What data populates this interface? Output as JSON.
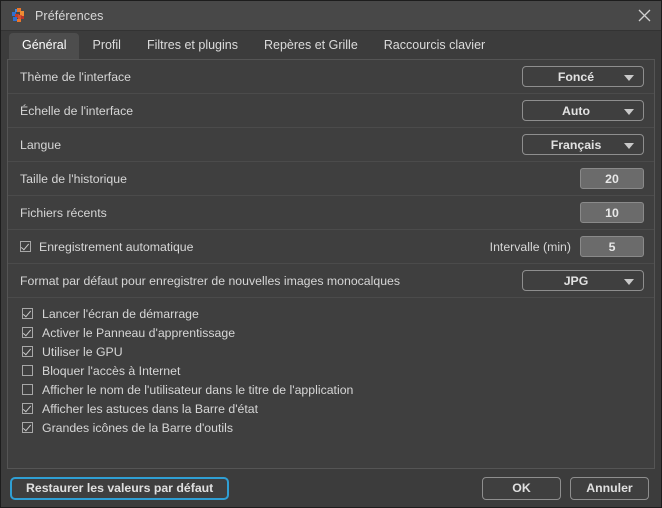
{
  "window": {
    "title": "Préférences",
    "app_icon": "application-logo-icon",
    "close_icon": "close-icon",
    "accent_color": "#2f9fd4",
    "background_color": "#3c3c3c",
    "panel_color": "#3f3f3f",
    "titlebar_color": "#484848"
  },
  "tabs": [
    {
      "label": "Général",
      "active": true
    },
    {
      "label": "Profil",
      "active": false
    },
    {
      "label": "Filtres et plugins",
      "active": false
    },
    {
      "label": "Repères et Grille",
      "active": false
    },
    {
      "label": "Raccourcis clavier",
      "active": false
    }
  ],
  "settings_rows": [
    {
      "label": "Thème de l'interface",
      "control": "dropdown",
      "value": "Foncé"
    },
    {
      "label": "Échelle de l'interface",
      "control": "dropdown",
      "value": "Auto"
    },
    {
      "label": "Langue",
      "control": "dropdown",
      "value": "Français"
    },
    {
      "label": "Taille de l'historique",
      "control": "number",
      "value": "20"
    },
    {
      "label": "Fichiers récents",
      "control": "number",
      "value": "10"
    }
  ],
  "autosave_row": {
    "checkbox_label": "Enregistrement automatique",
    "checked": true,
    "interval_label": "Intervalle (min)",
    "interval_value": "5"
  },
  "format_row": {
    "label": "Format par défaut pour enregistrer de nouvelles images monocalques",
    "value": "JPG"
  },
  "checkboxes": [
    {
      "label": "Lancer l'écran de démarrage",
      "checked": true
    },
    {
      "label": "Activer le Panneau d'apprentissage",
      "checked": true
    },
    {
      "label": "Utiliser le GPU",
      "checked": true
    },
    {
      "label": "Bloquer l'accès à Internet",
      "checked": false
    },
    {
      "label": "Afficher le nom de l'utilisateur dans le titre de l'application",
      "checked": false
    },
    {
      "label": "Afficher les astuces dans la Barre d'état",
      "checked": true
    },
    {
      "label": "Grandes icônes de la Barre d'outils",
      "checked": true
    }
  ],
  "buttons": {
    "restore_defaults": "Restaurer les valeurs par défaut",
    "ok": "OK",
    "cancel": "Annuler"
  }
}
